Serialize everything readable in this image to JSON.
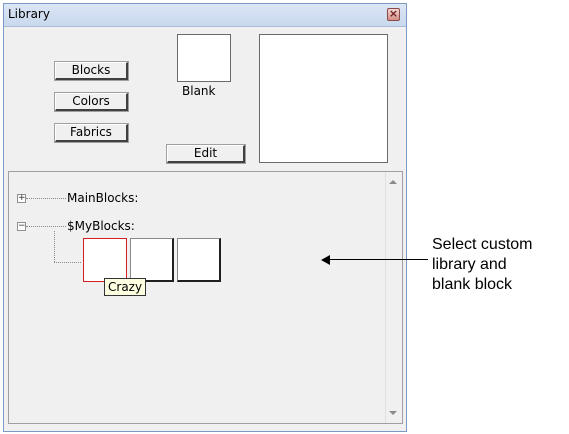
{
  "window": {
    "title": "Library",
    "close_glyph": "×"
  },
  "buttons": {
    "blocks": "Blocks",
    "colors": "Colors",
    "fabrics": "Fabrics",
    "edit": "Edit"
  },
  "preview": {
    "blank_label": "Blank"
  },
  "tree": {
    "nodes": [
      {
        "label": "MainBlocks:",
        "expander": "+"
      },
      {
        "label": "$MyBlocks:",
        "expander": "−"
      }
    ],
    "tooltip": "Crazy"
  },
  "annotation": {
    "line1": "Select custom",
    "line2": "library and",
    "line3": "blank block"
  },
  "icons": {
    "close": "close-icon",
    "scroll_up": "scroll-up-arrow-icon",
    "scroll_down": "scroll-down-arrow-icon"
  },
  "colors": {
    "selected_border": "#d42020",
    "tooltip_bg": "#ffffe1"
  }
}
